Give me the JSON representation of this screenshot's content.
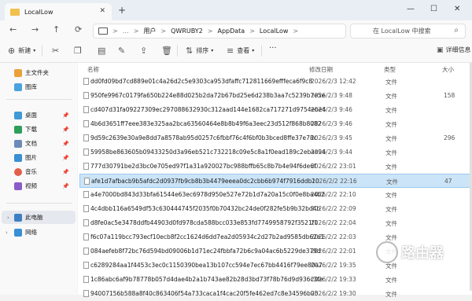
{
  "tab": {
    "title": "LocalLow",
    "close": "✕",
    "new": "+"
  },
  "window": {
    "minimize": "—",
    "maximize": "☐",
    "close": "✕"
  },
  "nav": {
    "back": "←",
    "forward": "→",
    "up": "↑",
    "refresh": "⟳"
  },
  "breadcrumb": {
    "items": [
      "用户",
      "QWRUBY2",
      "AppData",
      "LocalLow"
    ],
    "more": "…",
    "sep": ">"
  },
  "search": {
    "placeholder": "在 LocalLow 中搜索"
  },
  "toolbar": {
    "new": "新建",
    "sort": "排序",
    "view": "查看",
    "more": "···",
    "details": "详细信息"
  },
  "sidebar": {
    "home": "主文件夹",
    "gallery": "图库",
    "desktop": "桌面",
    "downloads": "下载",
    "documents": "文档",
    "pictures": "图片",
    "music": "音乐",
    "videos": "视频",
    "thispc": "此电脑",
    "network": "网络"
  },
  "columns": {
    "name": "名称",
    "date": "修改日期",
    "type": "类型",
    "size": "大小"
  },
  "files": [
    {
      "name": "dd0fd09bd7cd889e01c4a26d2c5e9303ca953dfaffc712811669efffeca6f9c8",
      "date": "2026/2/3 12:42",
      "type": "文件",
      "size": ""
    },
    {
      "name": "950fe9967c0179fa650b224e88d025b2da72b67bd25e6d238b3aa7c5239b7e5e",
      "date": "2026/2/3 9:48",
      "type": "文件",
      "size": "158"
    },
    {
      "name": "cd407d31fa09227309ec297088632930c312aad144e1682ca717271d9754ebe4",
      "date": "2026/2/3 9:46",
      "type": "文件",
      "size": ""
    },
    {
      "name": "4b6d3651ff7eee383e325aa2bca63560464e8b8b49f6a3eec23d512f868b8082",
      "date": "2026/2/3 9:46",
      "type": "文件",
      "size": ""
    },
    {
      "name": "9d59c2639e30a9e8dd7a8578ab95d0257c6fbbf76c4f6bf0b3bced8ffe37e78c",
      "date": "2026/2/3 9:45",
      "type": "文件",
      "size": "296"
    },
    {
      "name": "59958be863605b09433250d3a96eb521c732218c09e5c8a1f0ead189c2ebae94",
      "date": "2026/2/3 9:44",
      "type": "文件",
      "size": ""
    },
    {
      "name": "777d30791be2d3bc0e705ed97f1a31a920027bc988bffb65c8b7b4e94f6de6f",
      "date": "2026/2/2 23:01",
      "type": "文件",
      "size": ""
    },
    {
      "name": "afe1d7afbacb9b5afdc2d0937fb9cb8b3b4479eeea0dc2cbb6b974f7916ddb10",
      "date": "2026/2/2 22:16",
      "type": "文件",
      "size": "47"
    },
    {
      "name": "a4e7000bd843d33bfa61544e63ec6978d950e527e72b1d7a20a15c0f0e8ba4b2",
      "date": "2026/2/2 22:10",
      "type": "文件",
      "size": ""
    },
    {
      "name": "4c4dbb116a6549df53c630444745f2035f0b70432bc24de0f282fe5b9b32bd4b",
      "date": "2026/2/2 22:09",
      "type": "文件",
      "size": ""
    },
    {
      "name": "d8fe0ac5e3478ddfb44903d0fd978cda588bcc033e853fd7749958792f3521f1",
      "date": "2026/2/2 22:04",
      "type": "文件",
      "size": ""
    },
    {
      "name": "f6c07a119bcc793ecf10ecb8f2cc1624d6dd7ea2d05934c2d27b2ad9585db62e1",
      "date": "2026/2/2 22:03",
      "type": "文件",
      "size": ""
    },
    {
      "name": "084aefeb8f72bc76d594bd09006b1d71ec24fbbfa72b6c9a04ac6b5229de379d",
      "date": "2026/2/2 22:01",
      "type": "文件",
      "size": ""
    },
    {
      "name": "c6289284aa1f4453c3ec0c1150390bea13b107cc594e7ec67bb4416f79ee80a7",
      "date": "2026/2/2 19:35",
      "type": "文件",
      "size": ""
    },
    {
      "name": "1c86abc6af9b78778b057d4dae4b2a1b743ae82b28d3bd73f78b76d9d936c3fe",
      "date": "2026/2/2 19:33",
      "type": "文件",
      "size": ""
    },
    {
      "name": "94007156b588a8f40c863406f54a733caca1f4cac20f5fe462ed7c8e34596b05",
      "date": "2026/2/2 19:30",
      "type": "文件",
      "size": ""
    }
  ],
  "watermark": {
    "text": "路由器"
  }
}
